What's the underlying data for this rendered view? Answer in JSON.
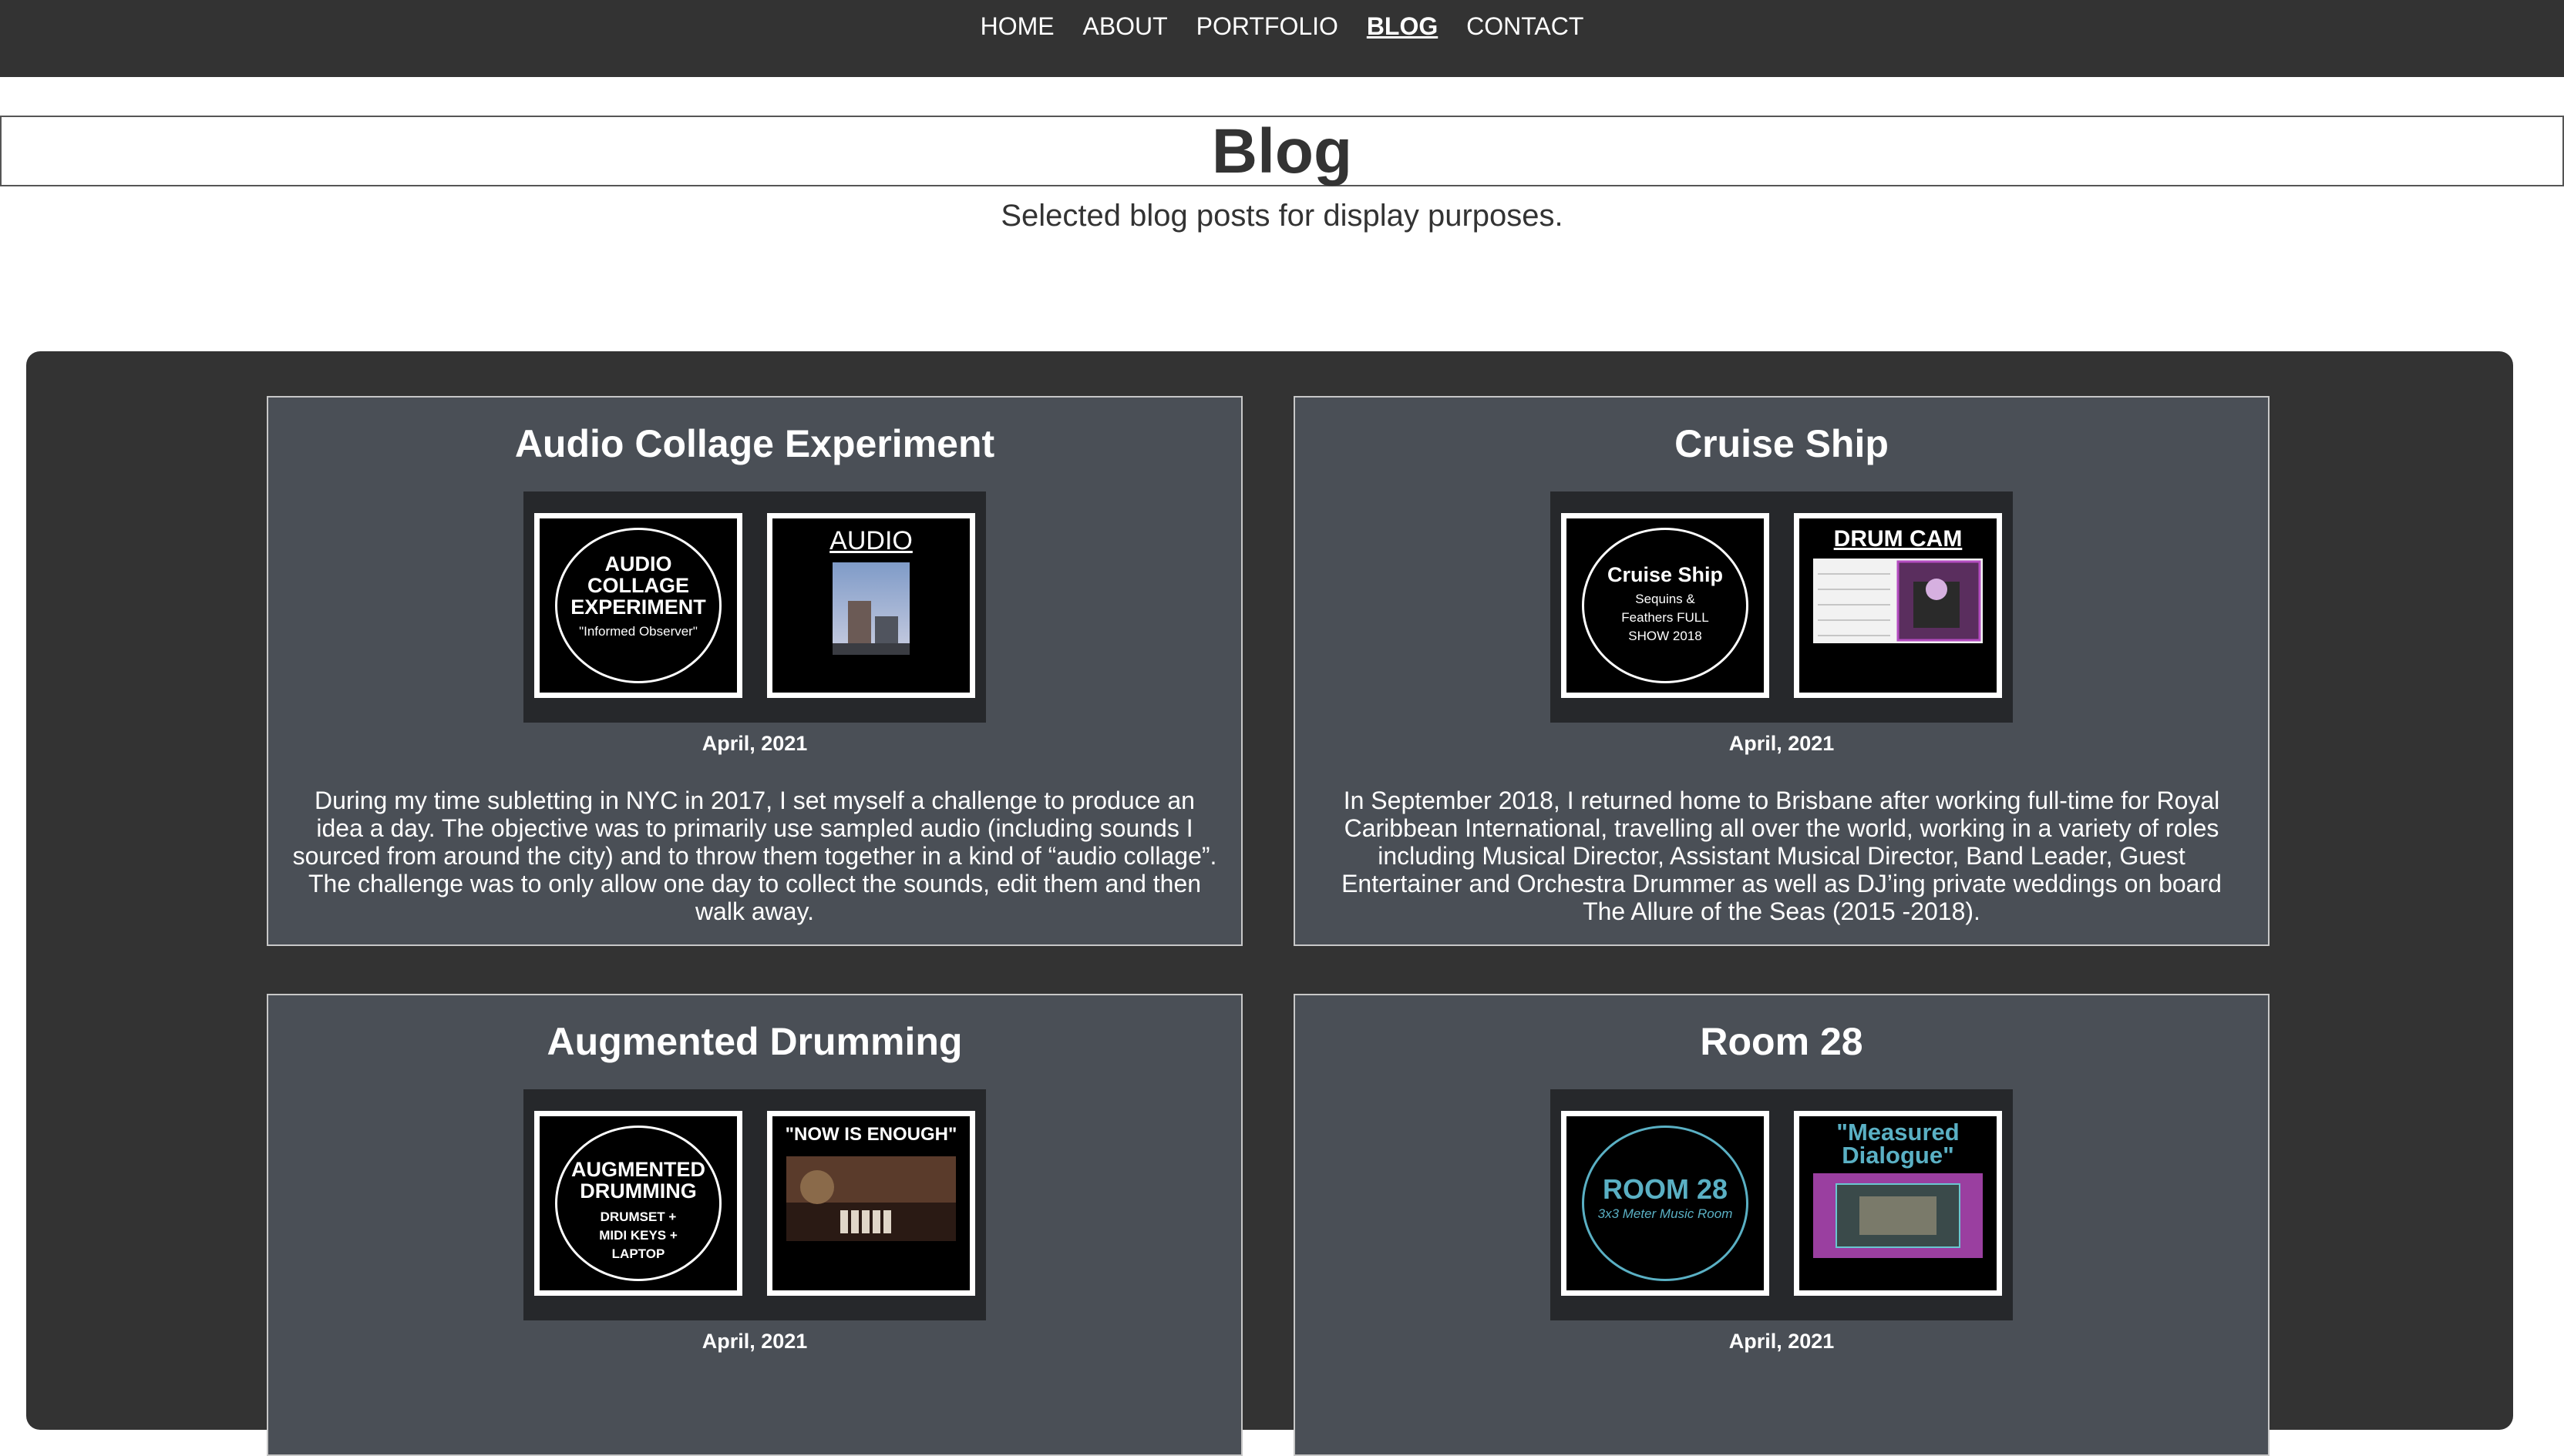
{
  "nav": {
    "items": [
      "HOME",
      "ABOUT",
      "PORTFOLIO",
      "BLOG",
      "CONTACT"
    ],
    "active": "BLOG"
  },
  "header": {
    "title": "Blog",
    "subtitle": "Selected blog posts for display purposes."
  },
  "posts": [
    {
      "title": "Audio Collage Experiment",
      "date": "April, 2021",
      "thumb_left": {
        "lines": [
          "AUDIO",
          "COLLAGE",
          "EXPERIMENT"
        ],
        "sub": "\"Informed Observer\""
      },
      "thumb_right": {
        "heading": "AUDIO"
      },
      "description": "During my time subletting in NYC in 2017, I set myself a challenge to produce an idea a day. The objective was to primarily use sampled audio (including sounds I sourced from around the city) and to throw them together in a kind of “audio collage”. The challenge was to only allow one day to collect the sounds, edit them and then walk away."
    },
    {
      "title": "Cruise Ship",
      "date": "April, 2021",
      "thumb_left": {
        "lines": [
          "Cruise Ship"
        ],
        "sub": "Sequins & Feathers FULL SHOW 2018"
      },
      "thumb_right": {
        "heading": "DRUM CAM"
      },
      "description": "In September 2018, I returned home to Brisbane after working full-time for Royal Caribbean International, travelling all over the world, working in a variety of roles including Musical Director, Assistant Musical Director, Band Leader, Guest Entertainer and Orchestra Drummer as well as DJ’ing private weddings on board The Allure of the Seas (2015 -2018)."
    },
    {
      "title": "Augmented Drumming",
      "date": "April, 2021",
      "thumb_left": {
        "lines": [
          "AUGMENTED",
          "DRUMMING"
        ],
        "sub": "DRUMSET + MIDI KEYS + LAPTOP"
      },
      "thumb_right": {
        "heading": "\"NOW IS ENOUGH\""
      }
    },
    {
      "title": "Room 28",
      "date": "April, 2021",
      "thumb_left": {
        "lines": [
          "ROOM 28"
        ],
        "sub": "3x3 Meter Music Room"
      },
      "thumb_right": {
        "heading": "\"Measured Dialogue\""
      }
    }
  ],
  "colors": {
    "nav_bg": "#333333",
    "panel_bg": "#333333",
    "card_bg": "#4a4f56",
    "accent_teal": "#5ab0c4"
  }
}
